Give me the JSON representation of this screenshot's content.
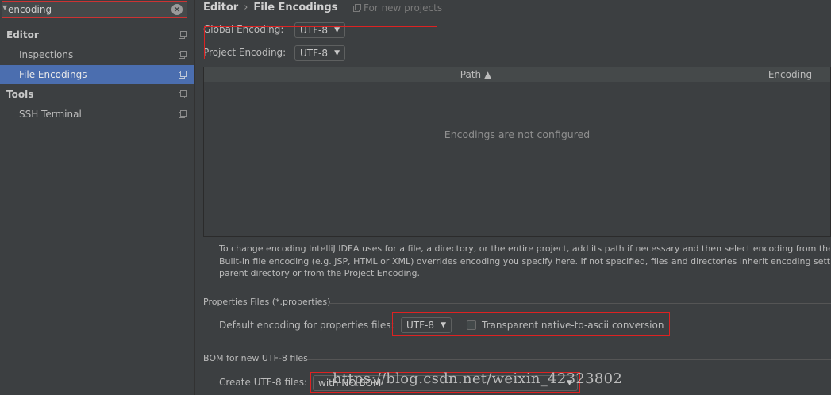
{
  "search": {
    "value": "encoding"
  },
  "sidebar": {
    "items": [
      {
        "label": "Editor",
        "kind": "section",
        "selected": false
      },
      {
        "label": "Inspections",
        "kind": "child",
        "selected": false
      },
      {
        "label": "File Encodings",
        "kind": "child",
        "selected": true
      },
      {
        "label": "Tools",
        "kind": "section",
        "selected": false
      },
      {
        "label": "SSH Terminal",
        "kind": "child",
        "selected": false
      }
    ]
  },
  "header": {
    "breadcrumb_parent": "Editor",
    "breadcrumb_separator": "›",
    "breadcrumb_current": "File Encodings",
    "scope_note": "For new projects"
  },
  "encodings": {
    "global_label": "Global Encoding:",
    "global_value": "UTF-8",
    "project_label": "Project Encoding:",
    "project_value": "UTF-8"
  },
  "table": {
    "col_path": "Path ▲",
    "col_encoding": "Encoding",
    "empty_text": "Encodings are not configured"
  },
  "help": {
    "line1": "To change encoding IntelliJ IDEA uses for a file, a directory, or the entire project, add its path if necessary and then select encoding from the encodi",
    "line2": "Built-in file encoding (e.g. JSP, HTML or XML) overrides encoding you specify here. If not specified, files and directories inherit encoding settings fr",
    "line3": "parent directory or from the Project Encoding."
  },
  "properties": {
    "group_title": "Properties Files (*.properties)",
    "default_label": "Default encoding for properties files:",
    "default_value": "UTF-8",
    "transparent_label": "Transparent native-to-ascii conversion",
    "transparent_checked": false
  },
  "bom": {
    "group_title": "BOM for new UTF-8 files",
    "create_label": "Create UTF-8 files:",
    "create_value": "with NO BOM"
  },
  "watermark": "https://blog.csdn.net/weixin_42323802",
  "colors": {
    "background": "#3c3f41",
    "selection": "#4b6eaf",
    "highlight_box": "#dd2222"
  }
}
